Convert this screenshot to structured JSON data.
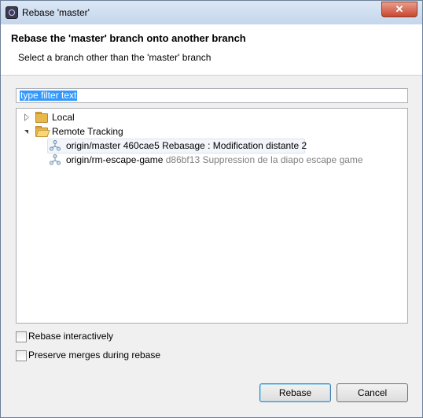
{
  "window": {
    "title": "Rebase 'master'",
    "close_glyph": "✕"
  },
  "header": {
    "title": "Rebase the 'master' branch onto another branch",
    "subtitle": "Select a branch other than the 'master' branch"
  },
  "filter": {
    "value": "type filter text"
  },
  "tree": {
    "local": {
      "label": "Local",
      "expanded": false,
      "icon": "folder-icon"
    },
    "remote": {
      "label": "Remote Tracking",
      "expanded": true,
      "icon": "folder-open-icon",
      "branches": [
        {
          "name": "origin/master",
          "commit": "460cae5 Rebasage : Modification distante 2",
          "selected": true,
          "icon": "remote-branch-icon"
        },
        {
          "name": "origin/rm-escape-game",
          "commit": "d86bf13 Suppression de la diapo escape game",
          "selected": false,
          "icon": "remote-branch-icon"
        }
      ]
    }
  },
  "options": {
    "interactive_label": "Rebase interactively",
    "interactive_checked": false,
    "preserve_merges_label": "Preserve merges during rebase",
    "preserve_merges_checked": false
  },
  "buttons": {
    "rebase_label": "Rebase",
    "cancel_label": "Cancel"
  },
  "colors": {
    "selection": "#3399ff",
    "folder": "#e9b84a",
    "branch_icon": "#6d8fb0",
    "commit_text": "#808080"
  }
}
